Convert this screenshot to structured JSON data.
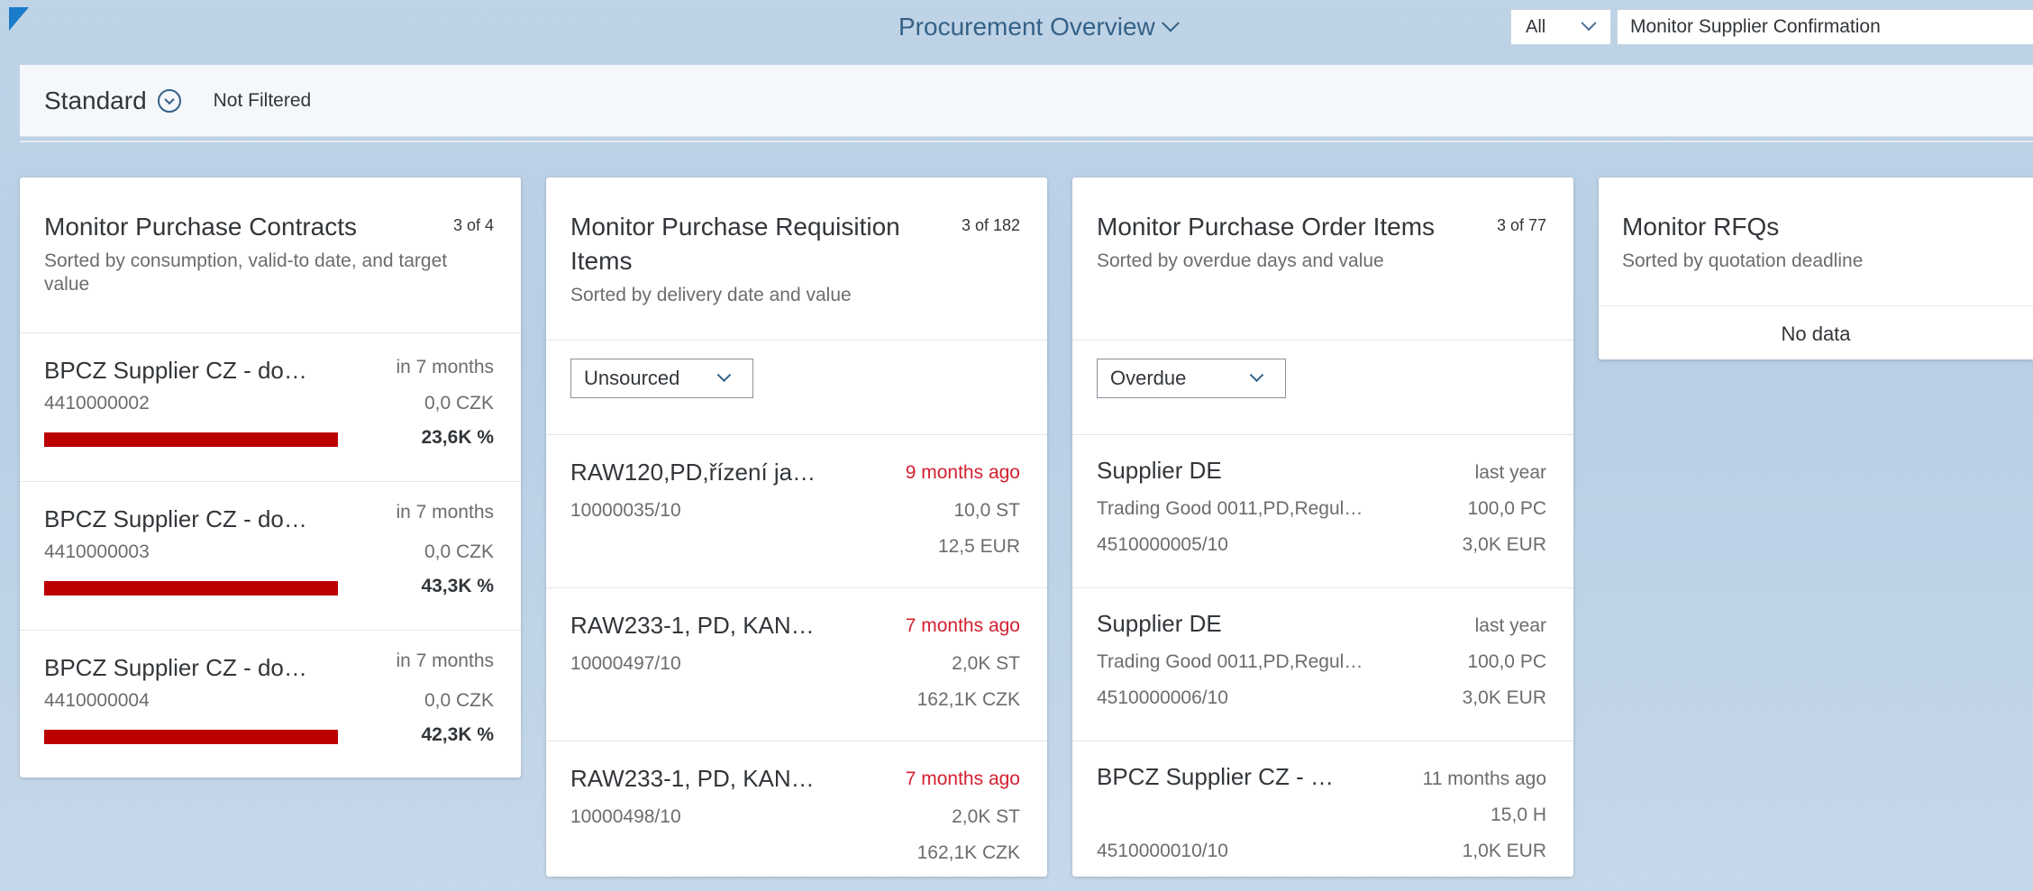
{
  "shell": {
    "app_title": "Procurement Overview",
    "scope": "All",
    "search_value": "Monitor Supplier Confirmation"
  },
  "filter_bar": {
    "variant": "Standard",
    "status": "Not Filtered"
  },
  "colors": {
    "accent": "#346187",
    "danger_bar": "#bb0000",
    "overdue_text": "#d32030"
  },
  "cards": {
    "contracts": {
      "title": "Monitor Purchase Contracts",
      "count": "3 of 4",
      "subtitle": "Sorted by consumption, valid-to date, and target value",
      "items": [
        {
          "name": "BPCZ Supplier CZ - do…",
          "number": "4410000002",
          "validity": "in 7 months",
          "value": "0,0 CZK",
          "consumption": "23,6K %",
          "progress": 1.0
        },
        {
          "name": "BPCZ Supplier CZ - do…",
          "number": "4410000003",
          "validity": "in 7 months",
          "value": "0,0 CZK",
          "consumption": "43,3K %",
          "progress": 1.0
        },
        {
          "name": "BPCZ Supplier CZ - do…",
          "number": "4410000004",
          "validity": "in 7 months",
          "value": "0,0 CZK",
          "consumption": "42,3K %",
          "progress": 1.0
        }
      ]
    },
    "requisitions": {
      "title": "Monitor Purchase Requisition Items",
      "count": "3 of 182",
      "subtitle": "Sorted by delivery date and value",
      "filter": "Unsourced",
      "items": [
        {
          "name": "RAW120,PD,řízení ja…",
          "date": "9 months ago",
          "number": "10000035/10",
          "quantity": "10,0 ST",
          "value": "12,5 EUR"
        },
        {
          "name": "RAW233-1, PD, KAN…",
          "date": "7 months ago",
          "number": "10000497/10",
          "quantity": "2,0K ST",
          "value": "162,1K CZK"
        },
        {
          "name": "RAW233-1, PD, KAN…",
          "date": "7 months ago",
          "number": "10000498/10",
          "quantity": "2,0K ST",
          "value": "162,1K CZK"
        }
      ]
    },
    "orders": {
      "title": "Monitor Purchase Order Items",
      "count": "3 of 77",
      "subtitle": "Sorted by overdue days and value",
      "filter": "Overdue",
      "items": [
        {
          "supplier": "Supplier DE",
          "date": "last year",
          "material": "Trading Good 0011,PD,Regul…",
          "quantity": "100,0 PC",
          "number": "4510000005/10",
          "value": "3,0K EUR"
        },
        {
          "supplier": "Supplier DE",
          "date": "last year",
          "material": "Trading Good 0011,PD,Regul…",
          "quantity": "100,0 PC",
          "number": "4510000006/10",
          "value": "3,0K EUR"
        },
        {
          "supplier": "BPCZ Supplier CZ - …",
          "date": "11 months ago",
          "material": "",
          "quantity": "15,0 H",
          "number": "4510000010/10",
          "value": "1,0K EUR"
        }
      ]
    },
    "rfqs": {
      "title": "Monitor RFQs",
      "subtitle": "Sorted by quotation deadline",
      "empty_text": "No data"
    }
  }
}
